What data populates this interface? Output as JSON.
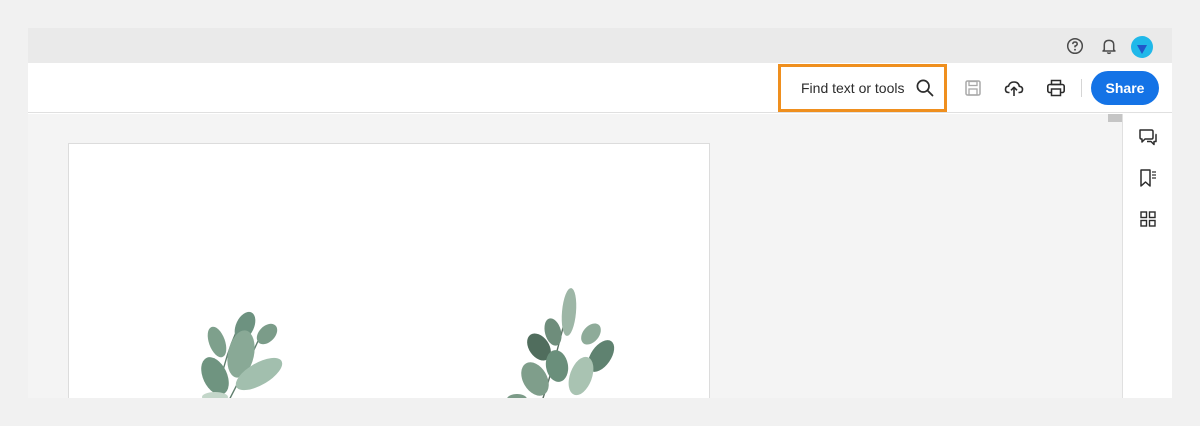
{
  "header": {
    "icons": [
      "help-icon",
      "notification-bell-icon"
    ],
    "avatar": "user-avatar"
  },
  "toolbar": {
    "find_label": "Find text or tools",
    "find_icon": "search-icon",
    "icons": [
      "save-icon",
      "upload-cloud-icon",
      "print-icon"
    ],
    "share_label": "Share"
  },
  "colors": {
    "accent": "#1473e6",
    "highlight": "#ef8f1e",
    "avatar": "#20b8e9"
  },
  "right_rail": {
    "icons": [
      "comment-icon",
      "bookmarks-icon",
      "thumbnails-icon"
    ]
  }
}
